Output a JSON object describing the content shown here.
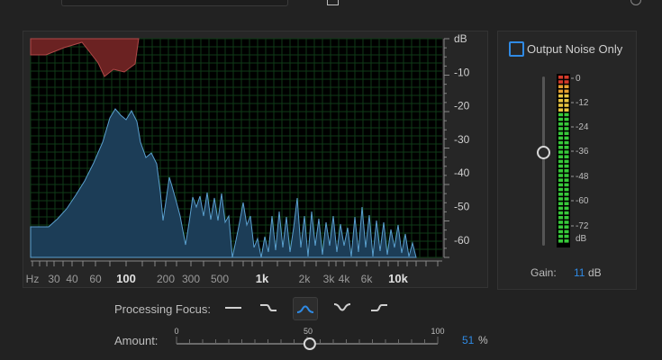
{
  "spectrum": {
    "y_unit": "dB",
    "y_ticks": [
      "-10",
      "-20",
      "-30",
      "-40",
      "-50",
      "-60"
    ],
    "x_ticks": [
      "Hz",
      "30",
      "40",
      "60",
      "100",
      "200",
      "300",
      "500",
      "1k",
      "2k",
      "3k",
      "4k",
      "6k",
      "10k"
    ],
    "colors": {
      "noise_fill": "#6b2222",
      "signal_fill": "#1c3d57",
      "signal_stroke": "#5aa0cf",
      "grid": "#0f3a17"
    }
  },
  "output_noise_only": {
    "label": "Output Noise Only",
    "checked": false
  },
  "meter": {
    "scale_labels": [
      "0",
      "-12",
      "-24",
      "-36",
      "-48",
      "-60",
      "-72",
      "dB"
    ]
  },
  "gain": {
    "label": "Gain:",
    "value": "11",
    "unit": "dB"
  },
  "processing_focus": {
    "label": "Processing Focus:",
    "options": [
      {
        "icon": "flat-focus-icon"
      },
      {
        "icon": "low-focus-icon"
      },
      {
        "icon": "mid-focus-icon",
        "active": true
      },
      {
        "icon": "notch-focus-icon"
      },
      {
        "icon": "high-focus-icon"
      }
    ]
  },
  "amount": {
    "label": "Amount:",
    "min": "0",
    "mid": "50",
    "max": "100",
    "value": "51",
    "unit": "%"
  }
}
